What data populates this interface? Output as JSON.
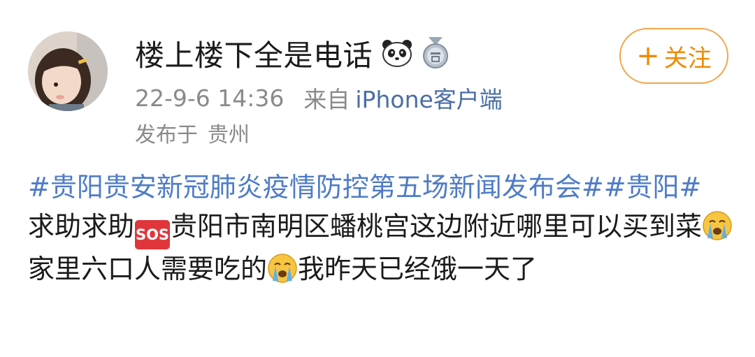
{
  "user": {
    "name": "楼上楼下全是电话",
    "badges": [
      "panda-icon",
      "medal-icon"
    ]
  },
  "meta": {
    "time": "22-9-6 14:36",
    "from_label": "来自",
    "source": "iPhone客户端",
    "location_label": "发布于",
    "location": "贵州"
  },
  "follow": {
    "plus": "+",
    "label": "关注"
  },
  "colors": {
    "topic": "#4f7cc7",
    "follow": "#f08a00",
    "sos": "#e0363b",
    "meta": "#8a8a8a"
  },
  "post": {
    "topic1": "#贵阳贵安新冠肺炎疫情防控第五场新闻发布会#",
    "topic2": "#贵阳#",
    "text1": " 求助求助",
    "sos_badge": "SOS",
    "text2": "贵阳市南明区蟠桃宫这边附近哪里可以买到菜",
    "text3": "家里六口人需要吃的",
    "text4": "我昨天已经饿一天了"
  }
}
